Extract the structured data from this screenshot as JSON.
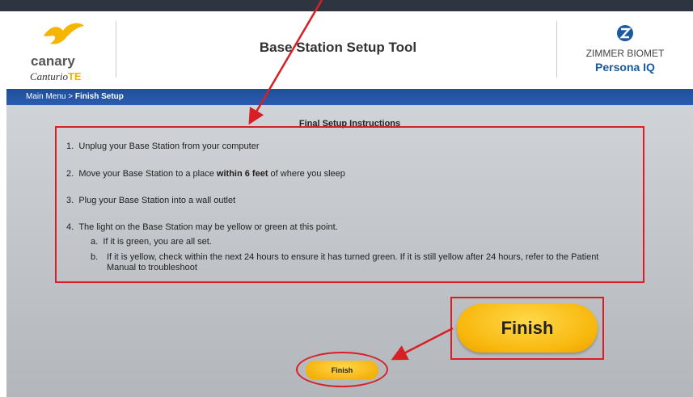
{
  "header": {
    "left_logo": {
      "brand": "canary",
      "sub_brand": "Canturio",
      "sub_brand_suffix": "TE"
    },
    "title": "Base Station Setup Tool",
    "right_logo": {
      "company": "ZIMMER BIOMET",
      "product": "Persona",
      "product_suffix": "IQ"
    }
  },
  "breadcrumb": {
    "parent": "Main Menu",
    "separator": ">",
    "current": "Finish Setup"
  },
  "instructions": {
    "title": "Final Setup Instructions",
    "steps": [
      {
        "num": "1.",
        "text": "Unplug your Base Station from your computer"
      },
      {
        "num": "2.",
        "text_before": "Move your Base Station to a place ",
        "text_bold": "within 6 feet",
        "text_after": " of where you sleep"
      },
      {
        "num": "3.",
        "text": "Plug your Base Station into a wall outlet"
      },
      {
        "num": "4.",
        "text": "The light on the Base Station may be yellow or green at this point."
      }
    ],
    "substeps": [
      {
        "letter": "a.",
        "text": "If it is green, you are all set."
      },
      {
        "letter": "b.",
        "text": "If it is yellow, check within the next 24 hours to ensure it has turned green. If it is still yellow after 24 hours, refer to the Patient Manual to troubleshoot"
      }
    ]
  },
  "finish_button_small": "Finish",
  "finish_button_zoomed": "Finish",
  "colors": {
    "accent_red": "#d91f26",
    "button_yellow": "#f8b70c",
    "nav_blue": "#2a5cb0",
    "logo_yellow": "#f0b400"
  },
  "icons": [
    "canary-bird-icon",
    "zimmer-biomet-z-icon"
  ]
}
